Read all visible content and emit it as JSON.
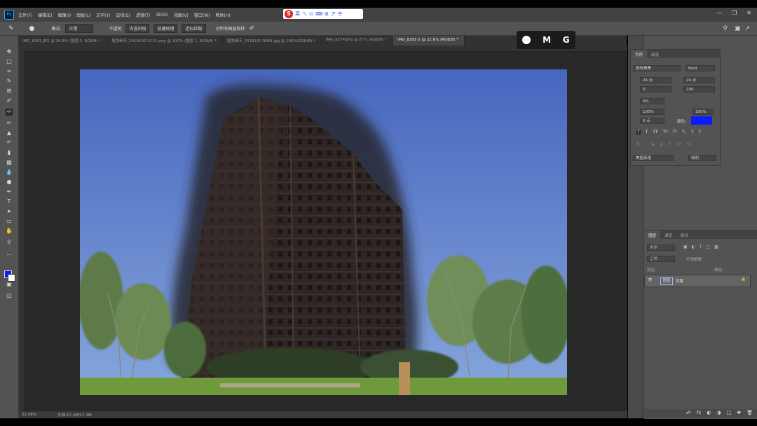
{
  "menu": {
    "items": [
      "文件(F)",
      "编辑(E)",
      "图像(I)",
      "图层(L)",
      "文字(Y)",
      "选择(S)",
      "滤镜(T)",
      "3D(D)",
      "视图(V)",
      "窗口(W)",
      "帮助(H)"
    ]
  },
  "ime_toolbar": {
    "logo_text": "S",
    "glyphs": [
      "英",
      "ㄟ",
      "⊙",
      "⌨",
      "⊞",
      "ア",
      "☰"
    ]
  },
  "options": {
    "mode_label": "模式:",
    "mode_value": "正常",
    "opacity_label": "不透明",
    "sample_value": "内容识别",
    "create_texture": "创建纹理",
    "proximity": "近似匹配",
    "sample_all": "对所有图层取样"
  },
  "tabs": [
    {
      "label": "IMG_8291.JPG @ 26.6% (图层 0, RGB/8) *",
      "active": false
    },
    {
      "label": "增强细节_2018100 9131.png @ 100% (图层 1, RGB/8) *",
      "active": false
    },
    {
      "label": "增强细节_2018100 9084.jpg @ 100%(RGB/8) *",
      "active": false
    },
    {
      "label": "IMG_8274.JPG @ 27% (RGB/8) *",
      "active": false
    },
    {
      "label": "IMG_8291-2 @ 22.6% (RGB/8) *",
      "active": true
    }
  ],
  "overlay_keys": {
    "key1": "M",
    "key2": "G"
  },
  "status": {
    "zoom": "22.58%",
    "doc": "文档:17.2M/17.2M"
  },
  "character_panel": {
    "tab_character": "字符",
    "tab_paragraph": "段落",
    "font_family": "微软雅黑",
    "font_style": "Bold",
    "size": "24 点",
    "leading": "24 点",
    "kerning": "0",
    "tracking": "100",
    "scale_v": "0%",
    "scale_v100": "100%",
    "scale_h100": "100%",
    "baseline": "0 点",
    "color_label": "颜色:",
    "antialias": "锐利",
    "language": "美国英语",
    "style_buttons": [
      "T",
      "T",
      "TT",
      "Tт",
      "T¹",
      "T₁",
      "T",
      "T"
    ]
  },
  "layers_panel": {
    "tabs": [
      "图层",
      "通道",
      "路径"
    ],
    "filter_label": "类型",
    "blend_mode": "正常",
    "opacity_label": "不透明度:",
    "lock_label": "锁定:",
    "fill_label": "填充:",
    "layer_name": "图层",
    "layer_label": "背景"
  },
  "colors": {
    "foreground": "#0b1bff",
    "background": "#ffffff",
    "sky_top": "#4a6bc0",
    "sky_bottom": "#7fa0d8"
  }
}
